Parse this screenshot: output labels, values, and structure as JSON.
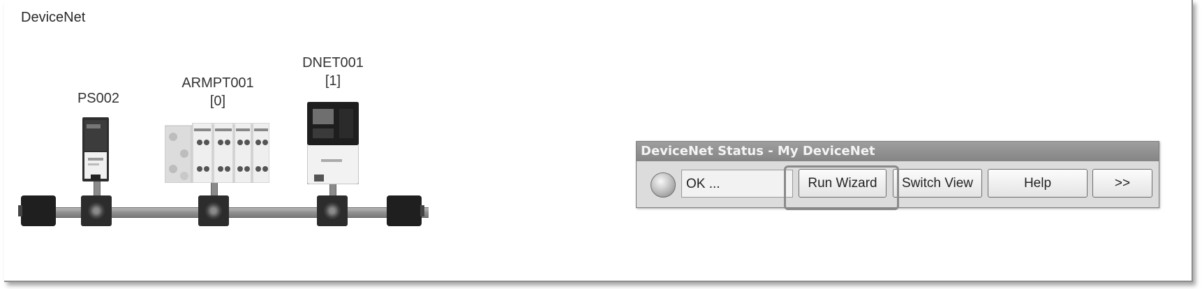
{
  "network": {
    "title": "DeviceNet",
    "devices": [
      {
        "name": "PS002",
        "address": ""
      },
      {
        "name": "ARMPT001",
        "address": "[0]"
      },
      {
        "name": "DNET001",
        "address": "[1]"
      }
    ]
  },
  "status_window": {
    "title": "DeviceNet Status - My DeviceNet",
    "status_text": "OK ...",
    "buttons": {
      "run_wizard": "Run Wizard",
      "switch_view": "Switch View",
      "help": "Help",
      "more": ">>"
    }
  },
  "colors": {
    "titlebar": "#858585",
    "body": "#dcdcdc",
    "highlight": "#8a8a8a"
  }
}
